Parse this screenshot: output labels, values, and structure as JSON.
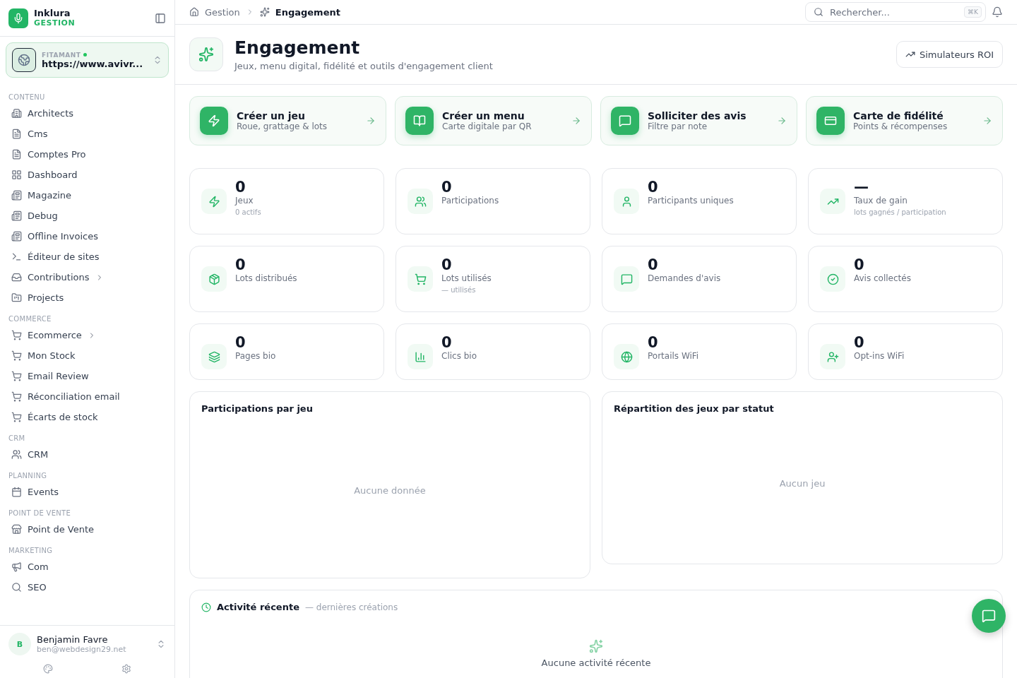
{
  "brand": {
    "name": "Inklura",
    "subtitle": "GESTION"
  },
  "workspace": {
    "label": "FITAMANT",
    "online": true,
    "url": "https://www.avivr..."
  },
  "sidebar": {
    "sections": [
      {
        "title": "CONTENU",
        "items": [
          {
            "label": "Architects",
            "expandable": false
          },
          {
            "label": "Cms",
            "expandable": false
          },
          {
            "label": "Comptes Pro",
            "expandable": false
          },
          {
            "label": "Dashboard",
            "expandable": false
          },
          {
            "label": "Magazine",
            "expandable": false
          },
          {
            "label": "Debug",
            "expandable": false
          },
          {
            "label": "Offline Invoices",
            "expandable": false
          },
          {
            "label": "Éditeur de sites",
            "expandable": false
          },
          {
            "label": "Contributions",
            "expandable": true
          },
          {
            "label": "Projects",
            "expandable": false
          }
        ]
      },
      {
        "title": "COMMERCE",
        "items": [
          {
            "label": "Ecommerce",
            "expandable": true
          },
          {
            "label": "Mon Stock",
            "expandable": false
          },
          {
            "label": "Email Review",
            "expandable": false
          },
          {
            "label": "Réconciliation email",
            "expandable": false
          },
          {
            "label": "Écarts de stock",
            "expandable": false
          }
        ]
      },
      {
        "title": "CRM",
        "items": [
          {
            "label": "CRM",
            "expandable": false
          }
        ]
      },
      {
        "title": "PLANNING",
        "items": [
          {
            "label": "Events",
            "expandable": false
          }
        ]
      },
      {
        "title": "POINT DE VENTE",
        "items": [
          {
            "label": "Point de Vente",
            "expandable": false
          }
        ]
      },
      {
        "title": "MARKETING",
        "items": [
          {
            "label": "Com",
            "expandable": false
          },
          {
            "label": "SEO",
            "expandable": false
          }
        ]
      }
    ]
  },
  "user": {
    "initial": "B",
    "name": "Benjamin Favre",
    "email": "ben@webdesign29.net"
  },
  "breadcrumb": [
    "Gestion",
    "Engagement"
  ],
  "search": {
    "placeholder": "Rechercher...",
    "shortcut": "⌘K"
  },
  "header": {
    "title": "Engagement",
    "subtitle": "Jeux, menu digital, fidélité et outils d'engagement client",
    "button": "Simulateurs ROI"
  },
  "actions": [
    {
      "title": "Créer un jeu",
      "subtitle": "Roue, grattage & lots"
    },
    {
      "title": "Créer un menu",
      "subtitle": "Carte digitale par QR"
    },
    {
      "title": "Solliciter des avis",
      "subtitle": "Filtre par note"
    },
    {
      "title": "Carte de fidélité",
      "subtitle": "Points & récompenses"
    }
  ],
  "stats": [
    {
      "value": "0",
      "label": "Jeux",
      "note": "0 actifs"
    },
    {
      "value": "0",
      "label": "Participations"
    },
    {
      "value": "0",
      "label": "Participants uniques"
    },
    {
      "value": "—",
      "label": "Taux de gain",
      "note": "lots gagnés / participation"
    },
    {
      "value": "0",
      "label": "Lots distribués"
    },
    {
      "value": "0",
      "label": "Lots utilisés",
      "note": "— utilisés"
    },
    {
      "value": "0",
      "label": "Demandes d'avis"
    },
    {
      "value": "0",
      "label": "Avis collectés"
    },
    {
      "value": "0",
      "label": "Pages bio"
    },
    {
      "value": "0",
      "label": "Clics bio"
    },
    {
      "value": "0",
      "label": "Portails WiFi"
    },
    {
      "value": "0",
      "label": "Opt-ins WiFi"
    }
  ],
  "panels": [
    {
      "title": "Participations par jeu",
      "empty": "Aucune donnée"
    },
    {
      "title": "Répartition des jeux par statut",
      "empty": "Aucun jeu"
    }
  ],
  "activity": {
    "title": "Activité récente",
    "note": "— dernières créations",
    "empty": "Aucune activité récente"
  }
}
